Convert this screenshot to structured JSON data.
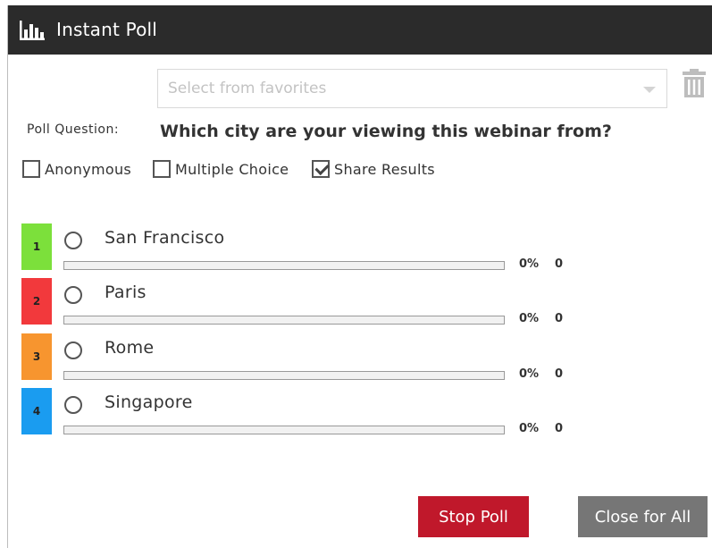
{
  "window": {
    "title": "Instant Poll",
    "icon": "bar-chart-icon"
  },
  "favorites": {
    "placeholder": "Select from favorites",
    "delete_icon": "trash-icon"
  },
  "question": {
    "label": "Poll Question:",
    "text": "Which city are your viewing this webinar from?"
  },
  "options": [
    {
      "label": "Anonymous",
      "checked": false
    },
    {
      "label": "Multiple Choice",
      "checked": false
    },
    {
      "label": "Share Results",
      "checked": true
    }
  ],
  "answers": [
    {
      "number": "1",
      "label": "San Francisco",
      "percent": "0%",
      "count": "0",
      "progress": 0,
      "color": "#7ce03b"
    },
    {
      "number": "2",
      "label": "Paris",
      "percent": "0%",
      "count": "0",
      "progress": 0,
      "color": "#f2393c"
    },
    {
      "number": "3",
      "label": "Rome",
      "percent": "0%",
      "count": "0",
      "progress": 0,
      "color": "#f7952f"
    },
    {
      "number": "4",
      "label": "Singapore",
      "percent": "0%",
      "count": "0",
      "progress": 0,
      "color": "#1a9cf0"
    }
  ],
  "buttons": {
    "stop": "Stop Poll",
    "close": "Close for All"
  },
  "colors": {
    "titlebar": "#2b2b2b",
    "stop_button": "#c0182b",
    "close_button": "#767676"
  }
}
